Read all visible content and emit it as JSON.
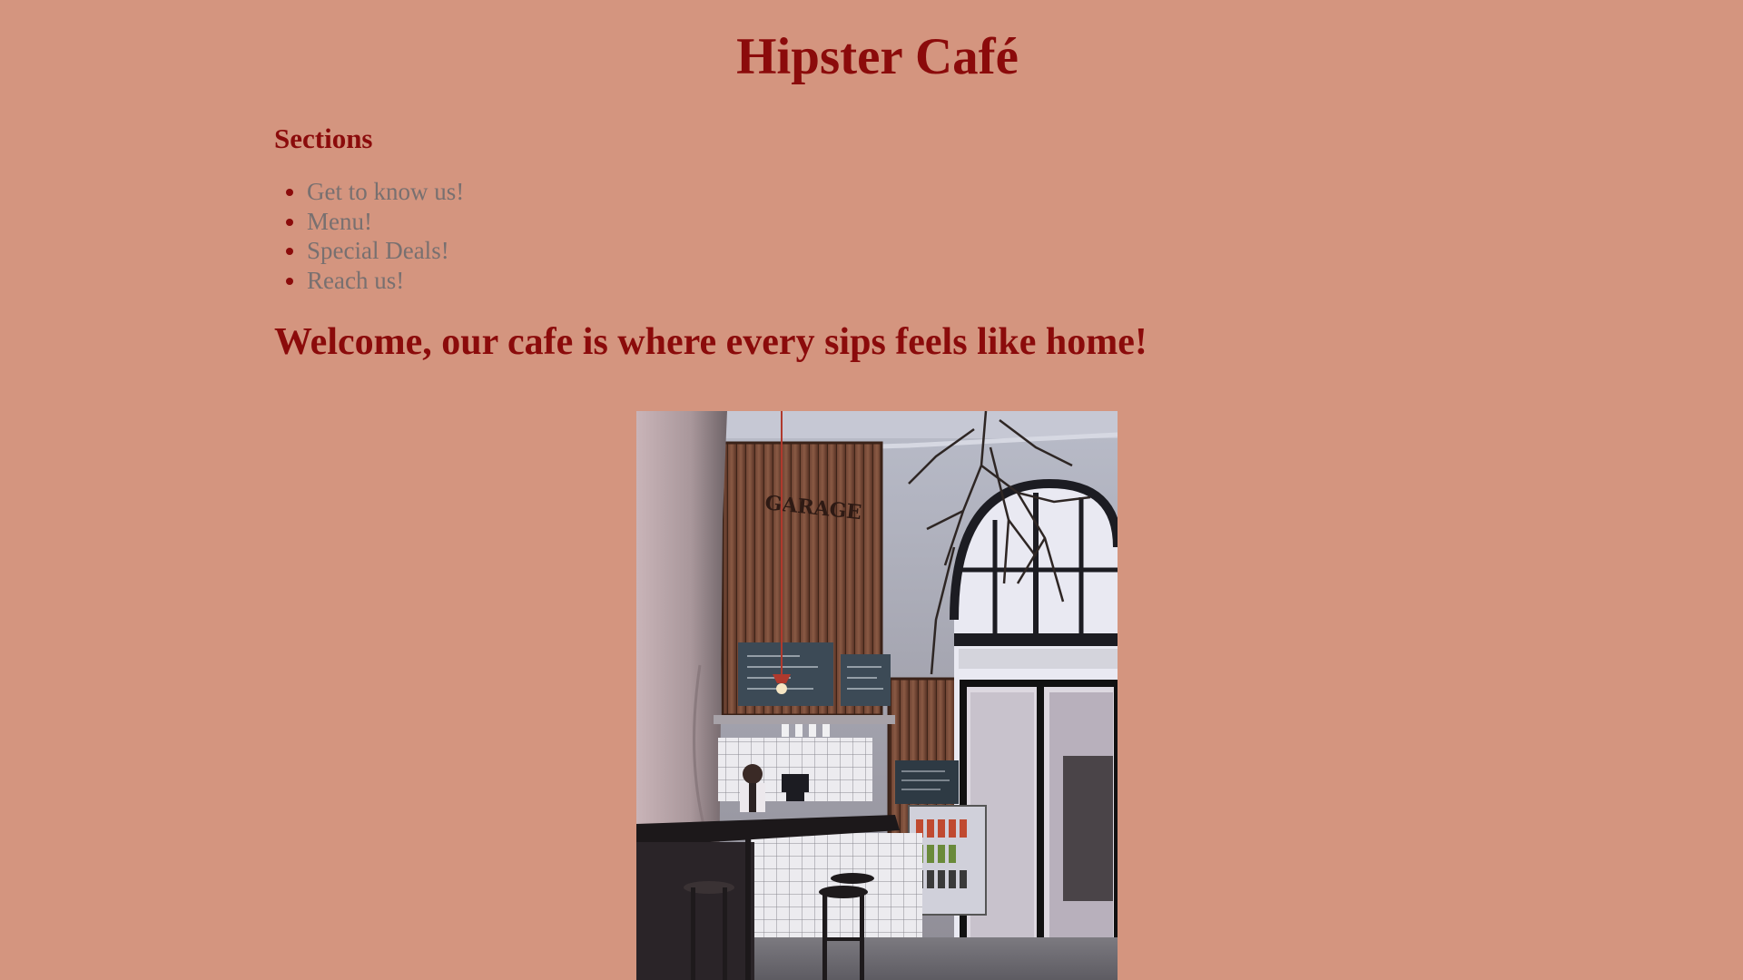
{
  "header": {
    "title": "Hipster Café"
  },
  "sections": {
    "heading": "Sections",
    "items": [
      {
        "label": "Get to know us!"
      },
      {
        "label": "Menu!"
      },
      {
        "label": "Special Deals!"
      },
      {
        "label": "Reach us!"
      }
    ]
  },
  "main": {
    "welcome": "Welcome, our cafe is where every sips feels like home!",
    "photo": {
      "sign_text": "GARAGE"
    }
  },
  "colors": {
    "background": "#d4957f",
    "heading": "#8b0b0b",
    "link": "#787070"
  }
}
